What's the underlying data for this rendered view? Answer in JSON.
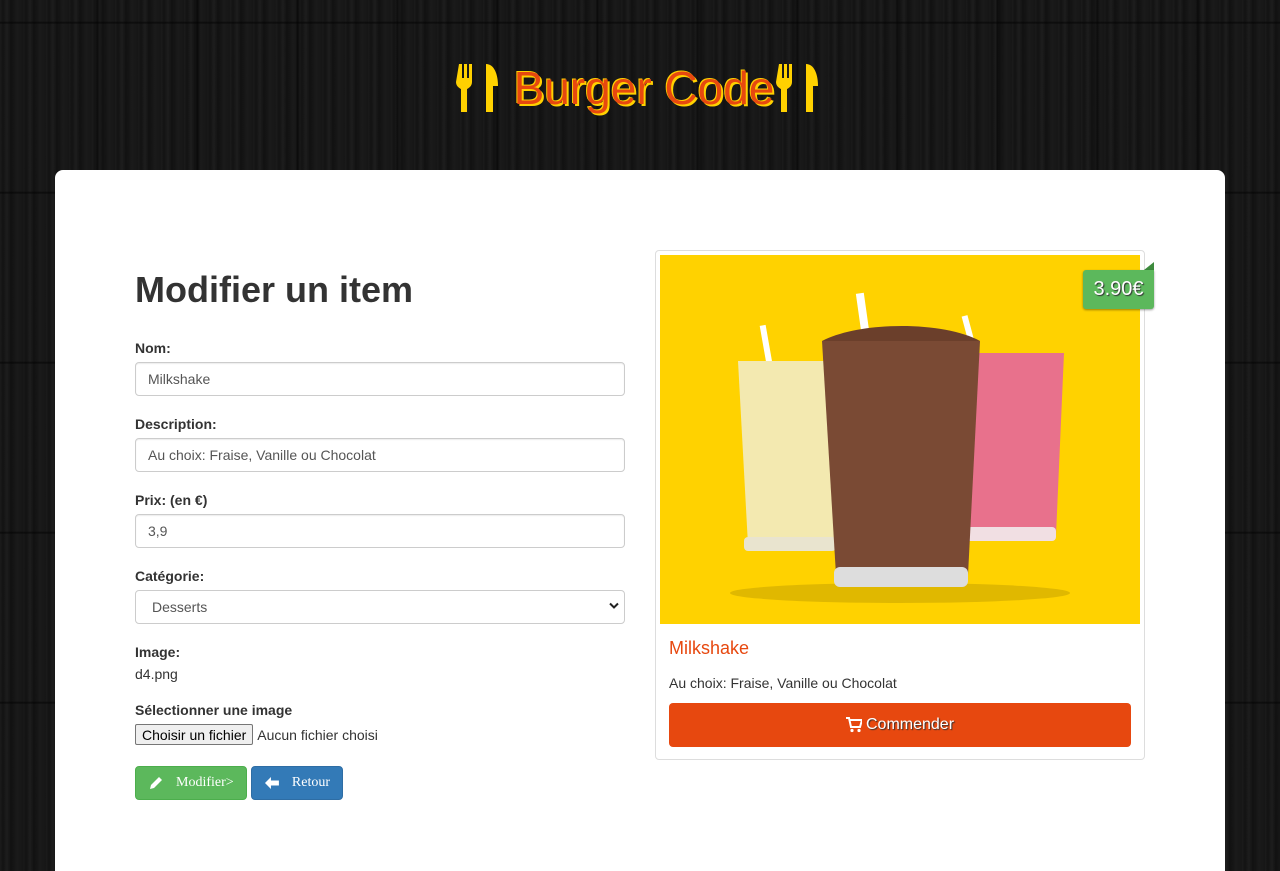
{
  "brand": {
    "title": "Burger Code"
  },
  "form": {
    "heading": "Modifier un item",
    "name_label": "Nom:",
    "name_value": "Milkshake",
    "description_label": "Description:",
    "description_value": "Au choix: Fraise, Vanille ou Chocolat",
    "price_label": "Prix: (en €)",
    "price_value": "3,9",
    "category_label": "Catégorie:",
    "category_value": "Desserts",
    "image_label": "Image:",
    "image_filename": "d4.png",
    "file_label": "Sélectionner une image",
    "file_button": "Choisir un fichier",
    "file_status": "Aucun fichier choisi",
    "submit_label": "Modifier>",
    "back_label": "Retour"
  },
  "preview": {
    "price": "3.90€",
    "name": "Milkshake",
    "description": "Au choix: Fraise, Vanille ou Chocolat",
    "order_label": "Commender"
  },
  "colors": {
    "brand_orange": "#e7480f",
    "brand_yellow": "#ffd200",
    "success": "#5cb85c",
    "primary": "#337ab7"
  },
  "icons": [
    "fork-knife-icon",
    "pencil-icon",
    "arrow-left-icon",
    "shopping-cart-icon",
    "chevron-down-icon"
  ]
}
